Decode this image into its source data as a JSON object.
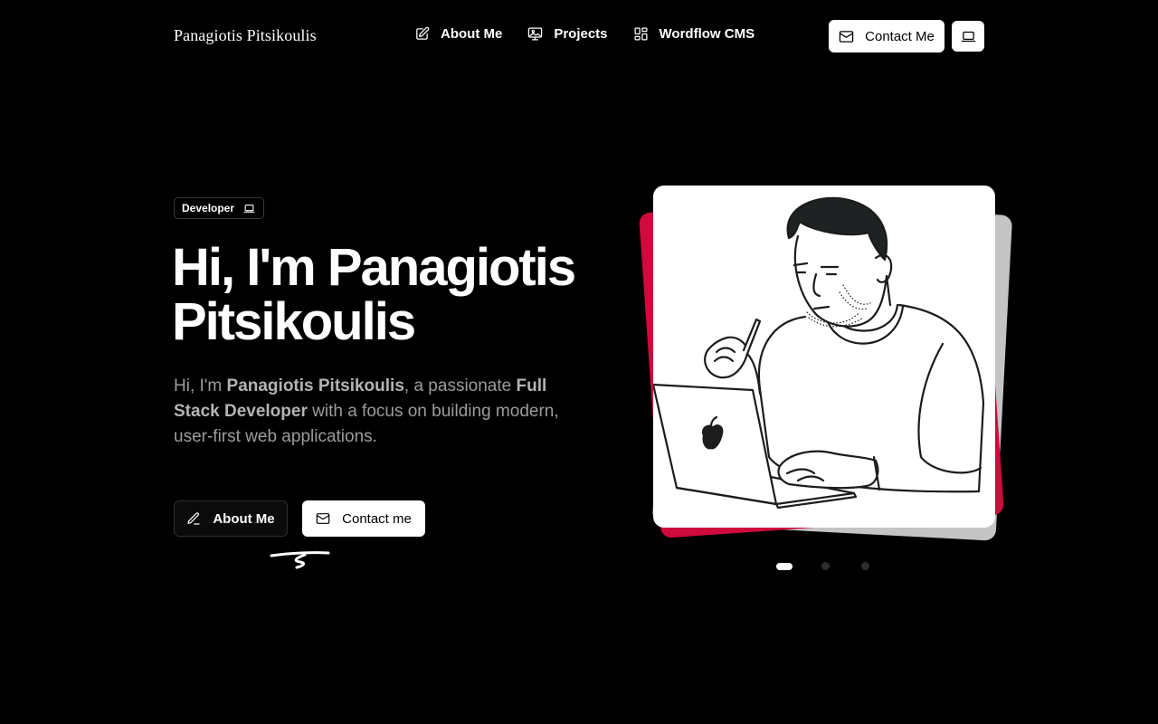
{
  "header": {
    "brand": "Panagiotis Pitsikoulis",
    "nav": [
      {
        "label": "About Me",
        "icon": "edit-icon"
      },
      {
        "label": "Projects",
        "icon": "image-monitor-icon"
      },
      {
        "label": "Wordflow CMS",
        "icon": "grid-icon"
      }
    ],
    "contact_label": "Contact Me",
    "theme_icon": "laptop-icon"
  },
  "hero": {
    "badge": "Developer",
    "title": "Hi, I'm Panagiotis Pitsikoulis",
    "intro_start": "Hi, I'm ",
    "intro_name": "Panagiotis Pitsikoulis",
    "intro_mid": ", a passionate ",
    "intro_role": "Full Stack Developer",
    "intro_end": " with a focus on building modern, user-first web applications.",
    "about_button": "About Me",
    "contact_button": "Contact me"
  },
  "carousel": {
    "slide_count": 3,
    "active_index": 0,
    "image": "developer-with-laptop-illustration"
  },
  "colors": {
    "background": "#000000",
    "accent_red": "#cf0a3d",
    "card_gray": "#c4c4c4",
    "text_muted": "#9c9c9c"
  }
}
